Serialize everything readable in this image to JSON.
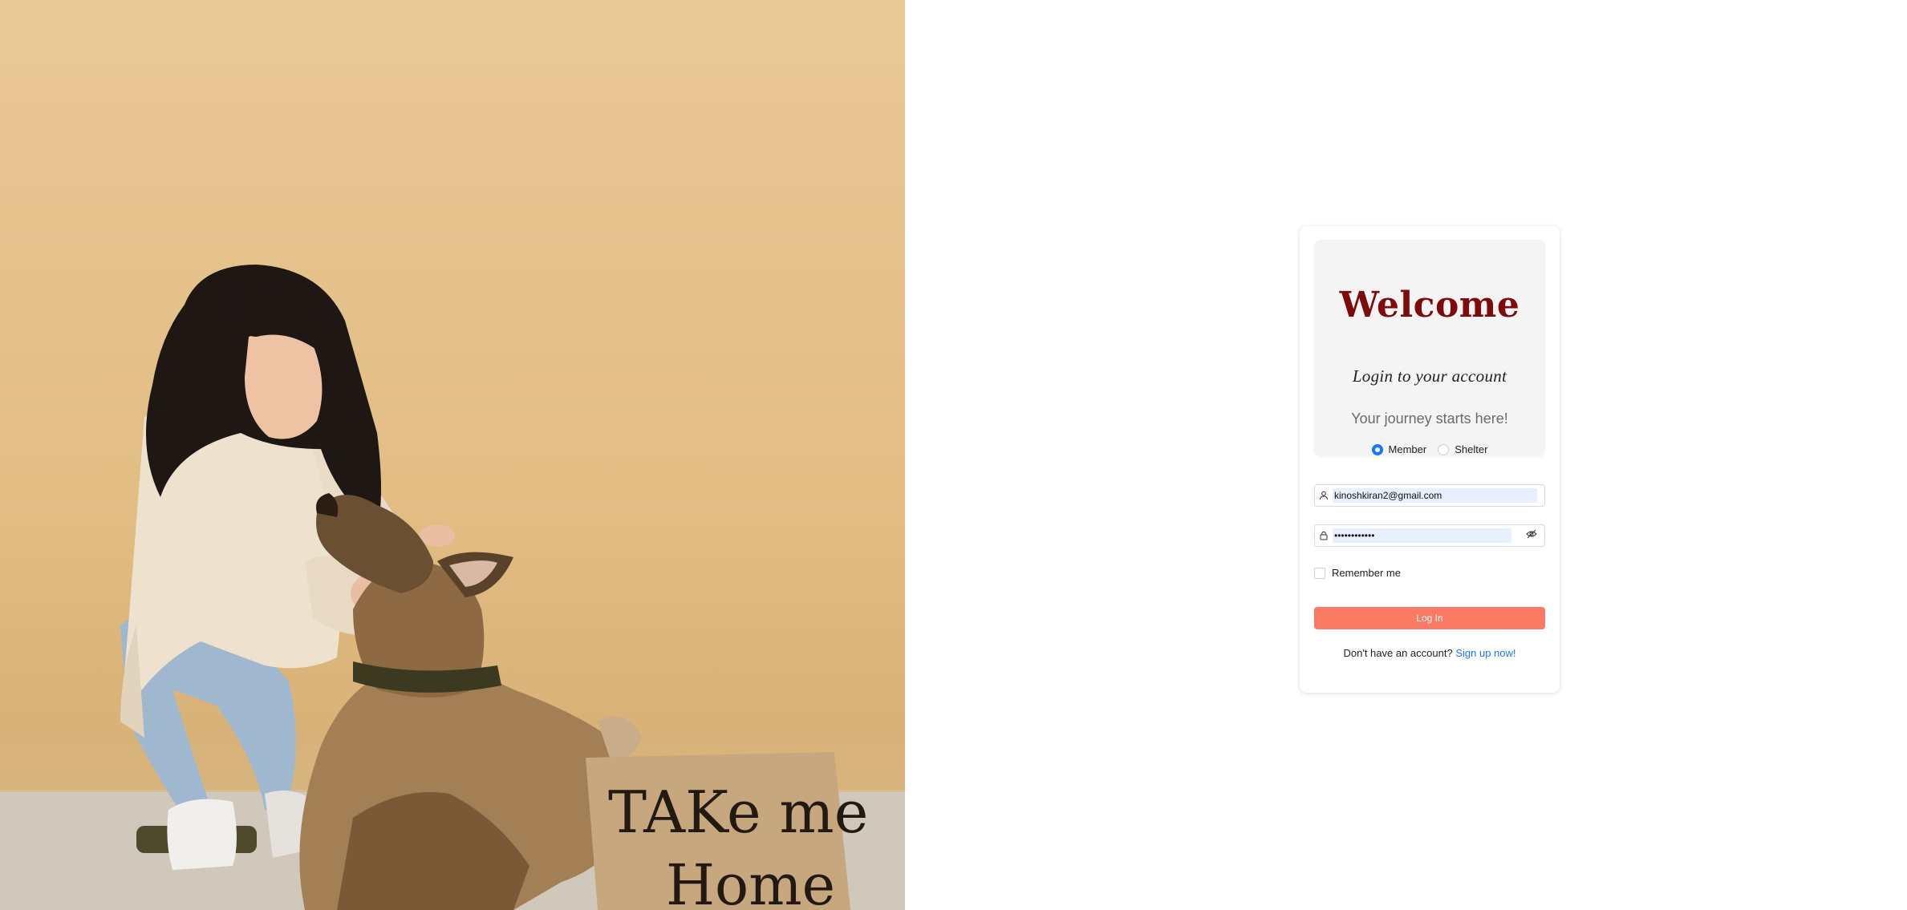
{
  "photo": {
    "description_icon": "woman-with-dog-photo",
    "sign_line1": "TAKe me",
    "sign_line2": "Home"
  },
  "card": {
    "title": "Welcome",
    "subtitle": "Login to your account",
    "tagline": "Your journey starts here!",
    "roles": [
      {
        "label": "Member",
        "selected": true
      },
      {
        "label": "Shelter",
        "selected": false
      }
    ],
    "email": {
      "value": "kinoshkiran2@gmail.com",
      "icon": "user-icon"
    },
    "password": {
      "value": "••••••••••••",
      "icon": "lock-icon",
      "toggle_icon": "eye-invisible-icon"
    },
    "remember_label": "Remember me",
    "login_label": "Log In",
    "signup_prompt": "Don't have an account?",
    "signup_link": "Sign up now!"
  },
  "colors": {
    "accent": "#fa7a64",
    "title": "#7e0a0a",
    "link": "#1677ff",
    "autofill": "#e8f0fe"
  }
}
